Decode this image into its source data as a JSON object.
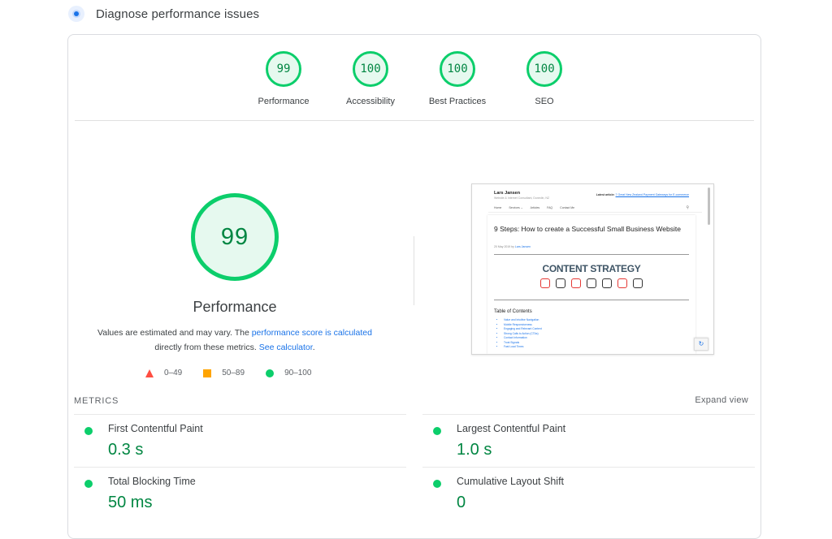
{
  "header": {
    "title": "Diagnose performance issues"
  },
  "categories": [
    {
      "score": "99",
      "label": "Performance"
    },
    {
      "score": "100",
      "label": "Accessibility"
    },
    {
      "score": "100",
      "label": "Best Practices"
    },
    {
      "score": "100",
      "label": "SEO"
    }
  ],
  "performance": {
    "score": "99",
    "label": "Performance",
    "note_prefix": "Values are estimated and may vary. The ",
    "note_link1": "performance score is calculated",
    "note_middle": " directly from these metrics. ",
    "note_link2": "See calculator",
    "note_suffix": "."
  },
  "legend": [
    {
      "range": "0–49",
      "color": "#ff4e42"
    },
    {
      "range": "50–89",
      "color": "#ffa400"
    },
    {
      "range": "90–100",
      "color": "#0cce6b"
    }
  ],
  "screenshot": {
    "site_name": "Lars Jansen",
    "site_subtitle": "Website & Internet Consultant, Dunedin, NZ",
    "latest_label": "Latest article:",
    "latest_link": "7 Great New Zealand Payment Gateways for E-commerce",
    "nav": [
      "Home",
      "Services ⌄",
      "Articles",
      "FAQ",
      "Contact Me"
    ],
    "article_title": "9 Steps: How to create a Successful Small Business Website",
    "article_date": "20 May 2019 by",
    "article_author": "Lars Jansen",
    "banner_text": "CONTENT STRATEGY",
    "toc_title": "Table of Contents",
    "toc_items": [
      "Value and Intuitive Navigation",
      "Mobile Responsiveness",
      "Engaging and Relevant Content",
      "Strong Calls to Action (CTAs)",
      "Contact Information",
      "Trust Signals",
      "Fast Load Times"
    ]
  },
  "metrics": {
    "title": "METRICS",
    "expand_label": "Expand view",
    "items": [
      {
        "name": "First Contentful Paint",
        "value": "0.3 s"
      },
      {
        "name": "Largest Contentful Paint",
        "value": "1.0 s"
      },
      {
        "name": "Total Blocking Time",
        "value": "50 ms"
      },
      {
        "name": "Cumulative Layout Shift",
        "value": "0"
      }
    ]
  },
  "colors": {
    "pass": "#0cce6b",
    "pass_text": "#018642",
    "link": "#1a73e8"
  }
}
